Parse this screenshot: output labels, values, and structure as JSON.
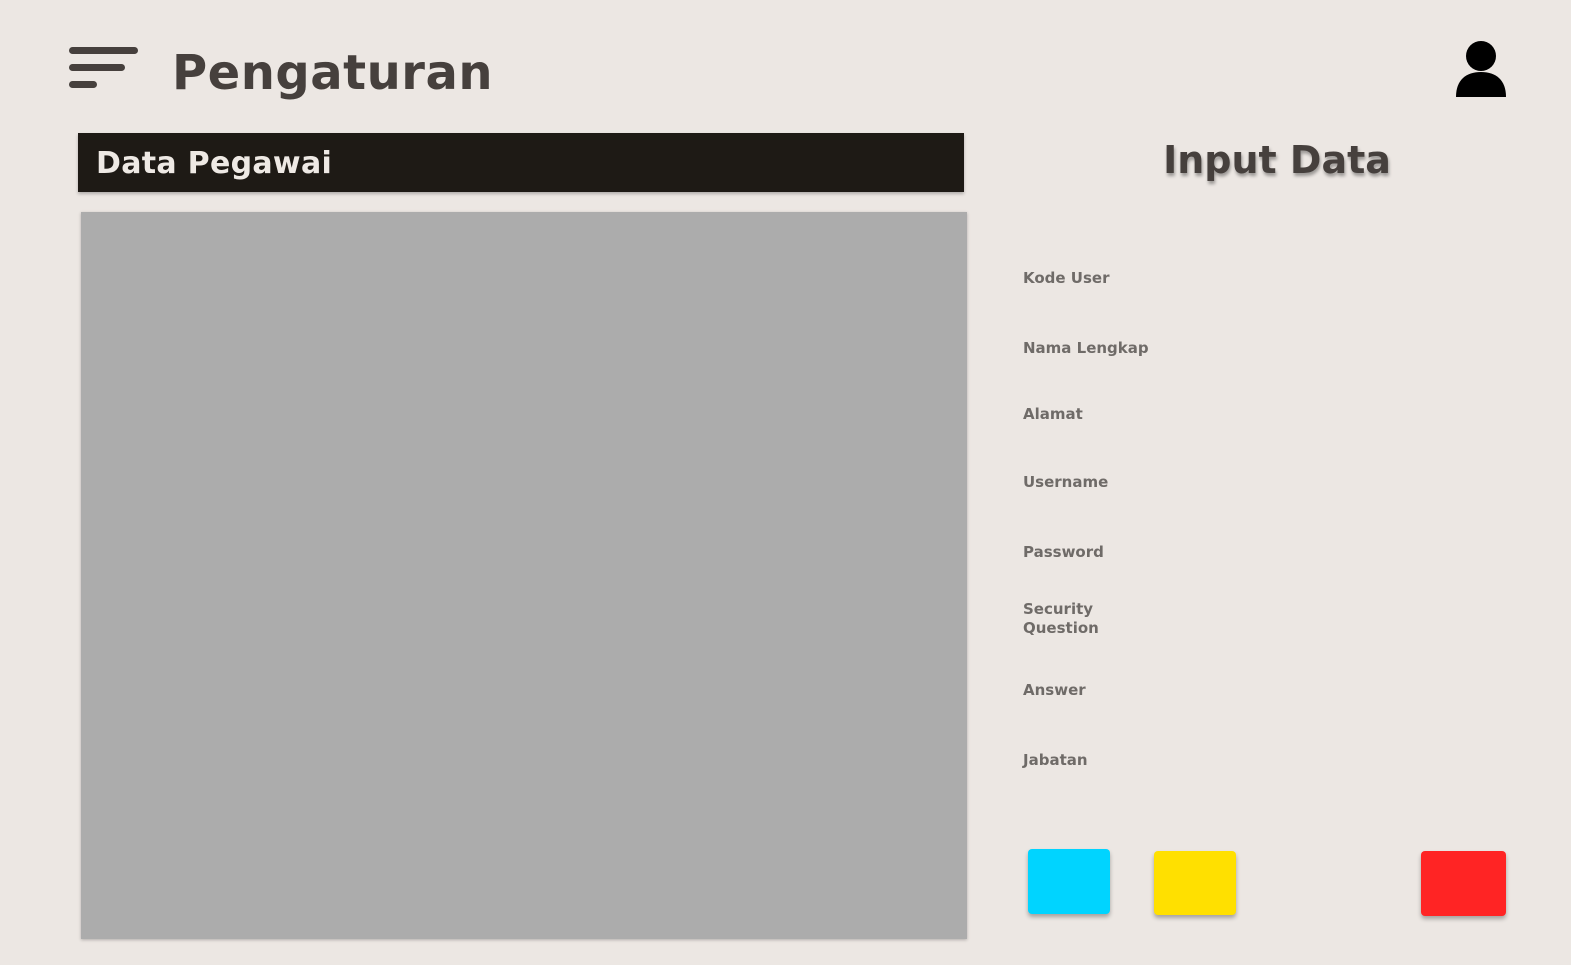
{
  "header": {
    "menu_icon": "hamburger-menu-icon",
    "title": "Pengaturan",
    "user_icon": "user-icon"
  },
  "employee_panel": {
    "title": "Data Pegawai"
  },
  "input_form": {
    "title": "Input Data",
    "fields": [
      {
        "label": "Kode User"
      },
      {
        "label": "Nama Lengkap"
      },
      {
        "label": "Alamat"
      },
      {
        "label": "Username"
      },
      {
        "label": "Password"
      },
      {
        "label": "Security Question"
      },
      {
        "label": "Answer"
      },
      {
        "label": "Jabatan"
      }
    ],
    "buttons": {
      "cyan": "#00d4ff",
      "yellow": "#ffe000",
      "red": "#ff2424"
    }
  },
  "colors": {
    "background": "#ece7e3",
    "title_text": "#46403d",
    "header_bar": "#1e1a15",
    "table_placeholder": "#acacac",
    "label_text": "#6f6b68"
  }
}
